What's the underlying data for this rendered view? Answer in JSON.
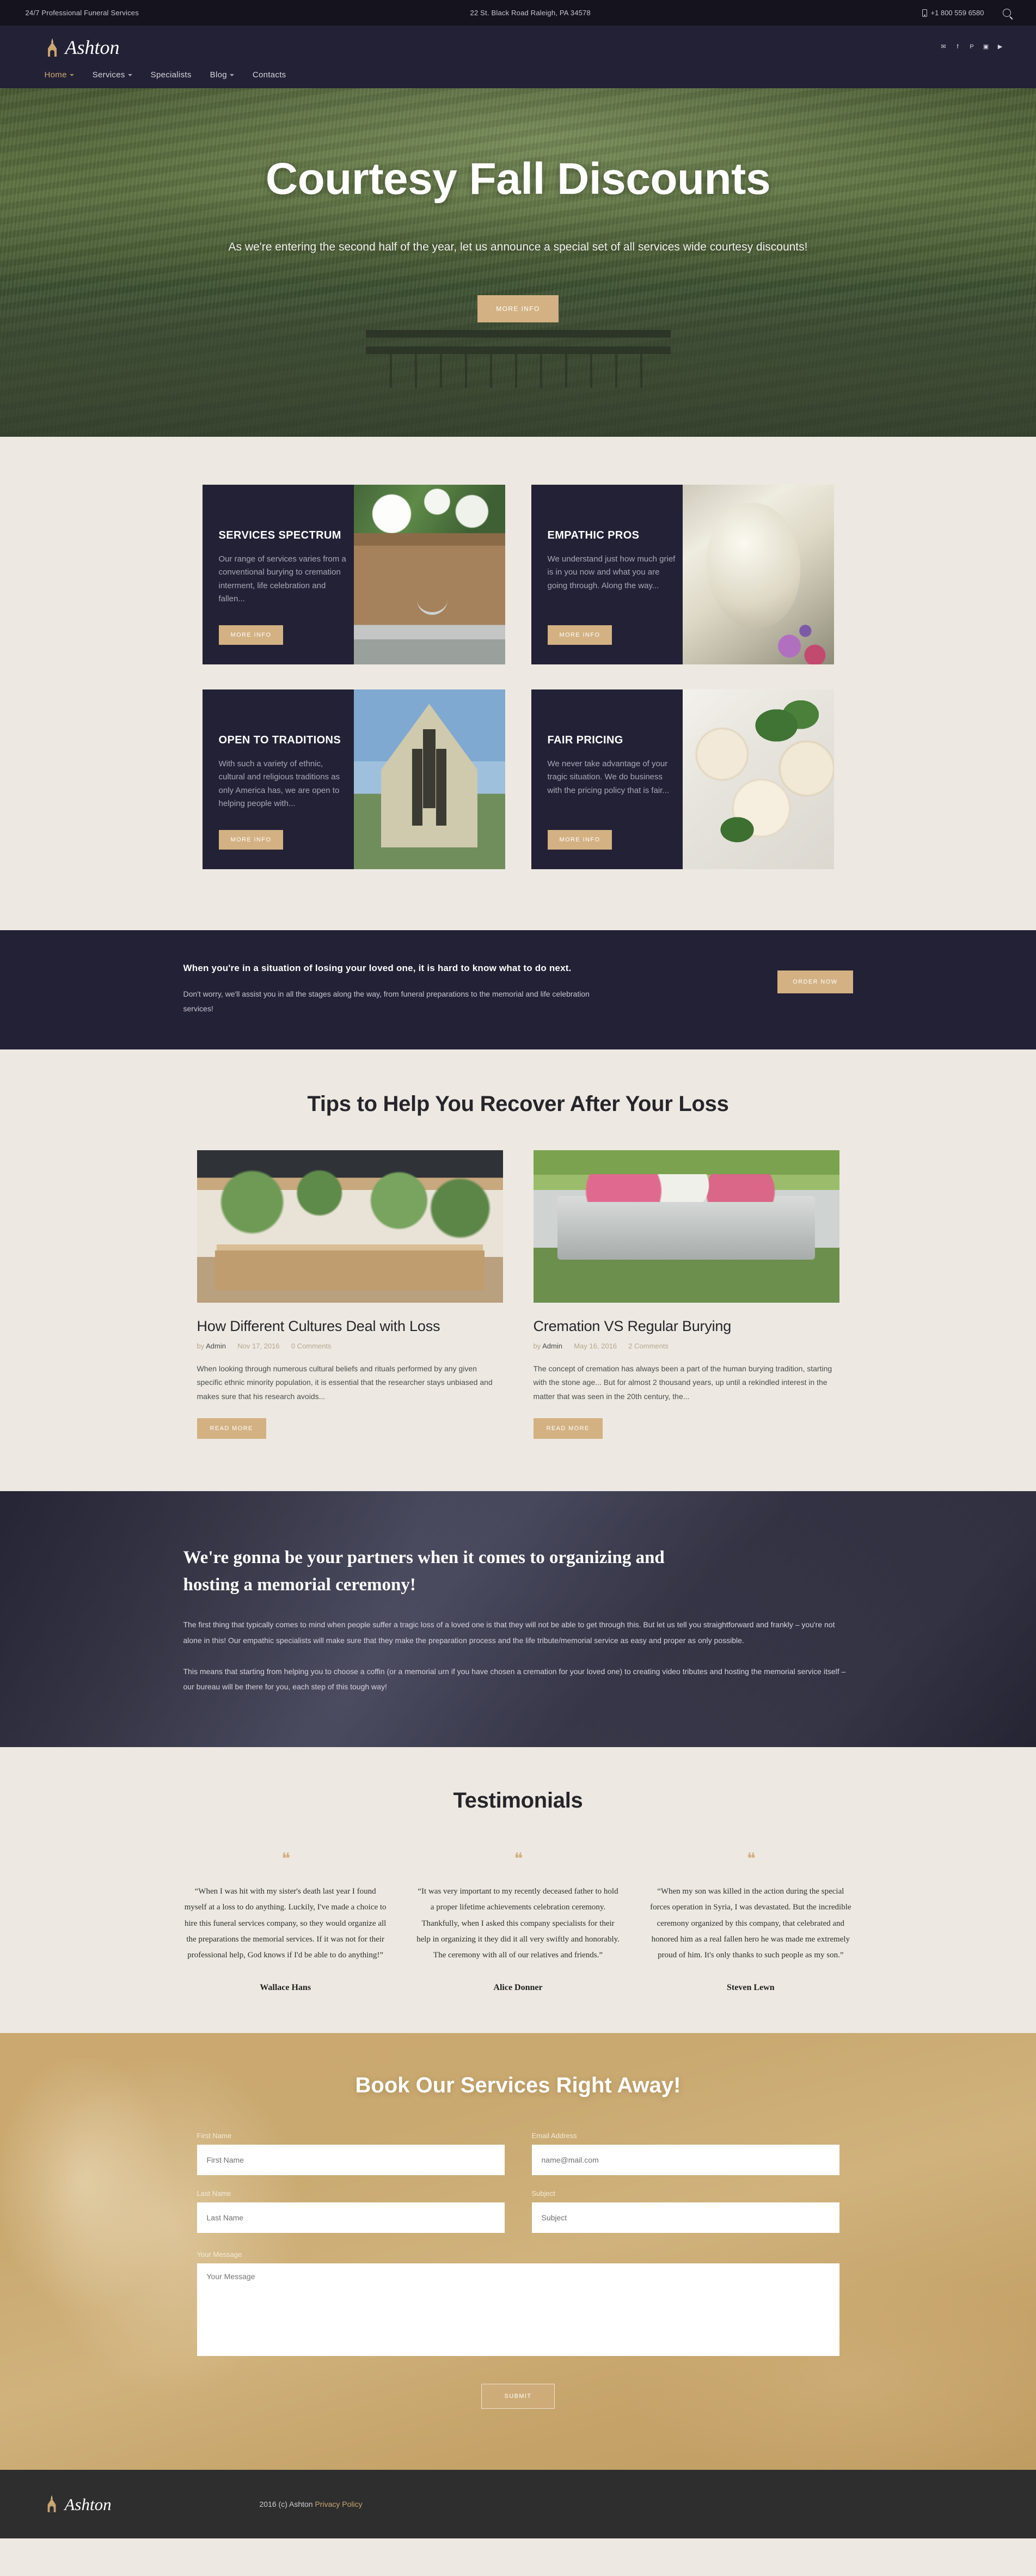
{
  "topbar": {
    "tagline": "24/7 Professional Funeral Services",
    "address": "22 St. Black Road Raleigh, PA 34578",
    "phone": "+1 800 559 6580",
    "search_icon": "search-icon",
    "phone_icon": "phone-icon"
  },
  "header": {
    "brand": "Ashton",
    "logo_icon": "church-logo-icon",
    "socials": [
      {
        "name": "twitter-icon",
        "glyph": "✉"
      },
      {
        "name": "facebook-icon",
        "glyph": "f"
      },
      {
        "name": "pinterest-icon",
        "glyph": "P"
      },
      {
        "name": "instagram-icon",
        "glyph": "▣"
      },
      {
        "name": "youtube-icon",
        "glyph": "▶"
      }
    ],
    "nav": [
      {
        "label": "Home",
        "has_caret": true,
        "active": true
      },
      {
        "label": "Services",
        "has_caret": true,
        "active": false
      },
      {
        "label": "Specialists",
        "has_caret": false,
        "active": false
      },
      {
        "label": "Blog",
        "has_caret": true,
        "active": false
      },
      {
        "label": "Contacts",
        "has_caret": false,
        "active": false
      }
    ]
  },
  "hero": {
    "title": "Courtesy Fall Discounts",
    "subtitle": "As we're entering the second half of the year, let us announce a special set of all services wide courtesy discounts!",
    "button": "MORE INFO"
  },
  "cards": [
    {
      "title": "SERVICES SPECTRUM",
      "body": "Our range of services varies from a conventional burying to cremation interment, life celebration and fallen...",
      "button": "MORE INFO",
      "image": "coffin-with-flowers-image"
    },
    {
      "title": "EMPATHIC PROS",
      "body": "We understand just how much grief is in you now and what you are going through. Along the way...",
      "button": "MORE INFO",
      "image": "angel-statue-image"
    },
    {
      "title": "OPEN TO TRADITIONS",
      "body": "With such a variety of ethnic, cultural and religious traditions as only America has, we are open to helping people with...",
      "button": "MORE INFO",
      "image": "church-building-image"
    },
    {
      "title": "FAIR PRICING",
      "body": "We never take advantage of your tragic situation. We do business with the pricing policy that is fair...",
      "button": "MORE INFO",
      "image": "white-roses-image"
    }
  ],
  "cta": {
    "heading": "When you're in a situation of losing your loved one, it is hard to know what to do next.",
    "paragraph": "Don't worry, we'll assist you in all the stages along the way, from funeral preparations to the memorial and life celebration services!",
    "button": "ORDER NOW"
  },
  "blog": {
    "title": "Tips to Help You Recover After Your Loss",
    "posts": [
      {
        "title": "How Different Cultures Deal with Loss",
        "by": "by",
        "author": "Admin",
        "date": "Nov 17, 2016",
        "comments": "0 Comments",
        "excerpt": "When looking through numerous cultural beliefs and rituals performed by any given specific ethnic minority population, it is essential that the researcher stays unbiased and makes sure that his research avoids...",
        "button": "READ MORE",
        "image": "flower-shop-interior-image"
      },
      {
        "title": "Cremation VS Regular Burying",
        "by": "by",
        "author": "Admin",
        "date": "May 16, 2016",
        "comments": "2 Comments",
        "excerpt": "The concept of cremation has always been a part of the human burying tradition, starting with the stone age... But for almost 2 thousand years, up until a rekindled interest in the matter that was seen in the 20th century, the...",
        "button": "READ MORE",
        "image": "casket-with-flowers-image"
      }
    ]
  },
  "partners": {
    "heading": "We're gonna be your partners when it comes to organizing and hosting a memorial ceremony!",
    "paragraph1": "The first thing that typically comes to mind when people suffer a tragic loss of a loved one is that they will not be able to get through this. But let us tell you straightforward and frankly – you're not alone in this! Our empathic specialists will make sure that they make the preparation process and the life tribute/memorial service as easy and proper as only possible.",
    "paragraph2": "This means that starting from helping you to choose a coffin (or a memorial urn if you have chosen a cremation for your loved one) to creating video tributes and hosting the memorial service itself – our bureau will be there for you, each step of this tough way!"
  },
  "testimonials": {
    "title": "Testimonials",
    "quote_glyph": "❝",
    "items": [
      {
        "text": "“When I was hit with my sister's death last year I found myself at a loss to do anything. Luckily, I've made a choice to hire this funeral services company, so they would organize all the preparations the memorial services. If it was not for their professional help, God knows if I'd be able to do anything!”",
        "name": "Wallace Hans"
      },
      {
        "text": "“It was very important to my recently deceased father to hold a proper lifetime achievements celebration ceremony. Thankfully, when I asked this company specialists for their help in organizing it they did it all very swiftly and honorably. The ceremony with all of our relatives and friends.”",
        "name": "Alice Donner"
      },
      {
        "text": "“When my son was killed in the action during the special forces operation in Syria, I was devastated. But the incredible ceremony organized by this company, that celebrated and honored him as a real fallen hero he was made me extremely proud of him. It's only thanks to such people as my son.”",
        "name": "Steven Lewn"
      }
    ]
  },
  "booking": {
    "title": "Book Our Services Right Away!",
    "fields": {
      "first_name_label": "First Name",
      "first_name_placeholder": "First Name",
      "last_name_label": "Last Name",
      "last_name_placeholder": "Last Name",
      "email_label": "Email Address",
      "email_placeholder": "name@mail.com",
      "subject_label": "Subject",
      "subject_placeholder": "Subject",
      "message_label": "Your Message",
      "message_placeholder": "Your Message"
    },
    "submit": "SUBMIT"
  },
  "footer": {
    "brand": "Ashton",
    "logo_icon": "church-logo-icon",
    "copyright": "2016 (c) Ashton",
    "privacy": "Privacy Policy"
  },
  "colors": {
    "accent": "#d3b183",
    "dark": "#232135",
    "topbar": "#15131e",
    "page_bg": "#ede9e2",
    "footer": "#2e2e2e"
  }
}
